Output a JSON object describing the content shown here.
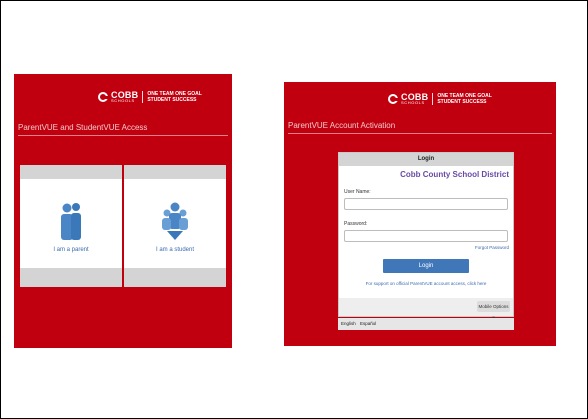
{
  "brand": {
    "name": "COBB",
    "sub": "SCHOOLS",
    "tagline_line1": "ONE TEAM ONE GOAL",
    "tagline_line2": "STUDENT SUCCESS"
  },
  "left": {
    "title": "ParentVUE and StudentVUE Access",
    "cards": [
      {
        "label": "I am a parent",
        "icon": "parent-icon"
      },
      {
        "label": "I am a student",
        "icon": "student-icon"
      }
    ]
  },
  "right": {
    "title": "ParentVUE Account Activation",
    "login": {
      "heading": "Login",
      "district": "Cobb County School District",
      "username_label": "User Name:",
      "password_label": "Password:",
      "forgot": "Forgot Password",
      "button": "Login",
      "support": "For support on official ParentVUE account access, click here",
      "mobile": "Mobile Options"
    },
    "languages": [
      "English",
      "Español"
    ]
  },
  "colors": {
    "brand_red": "#c1000f",
    "link_blue": "#3a6bb0",
    "button_blue": "#3f77b8",
    "district_purple": "#6a4aa5"
  }
}
